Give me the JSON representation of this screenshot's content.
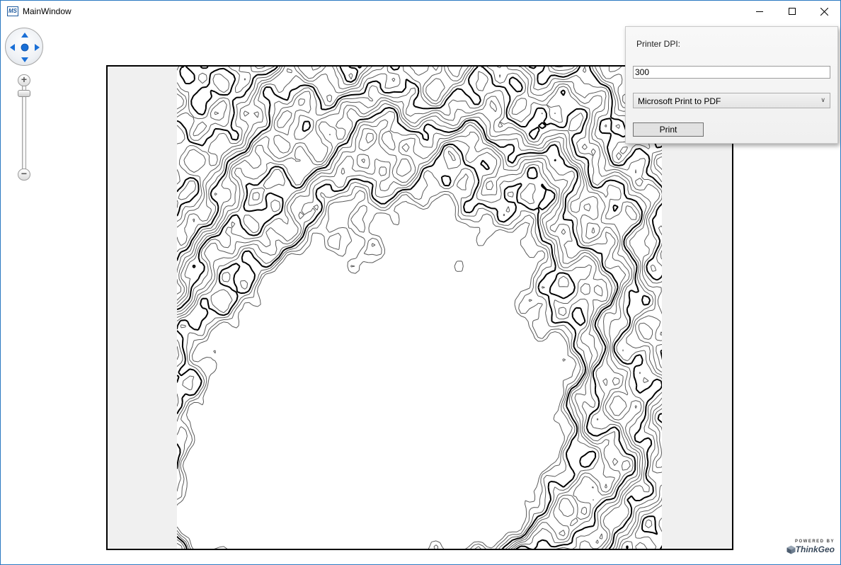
{
  "window": {
    "title": "MainWindow",
    "app_icon_text": "MS",
    "controls": {
      "minimize": "minimize-icon",
      "maximize": "maximize-icon",
      "close": "close-icon"
    }
  },
  "map_controls": {
    "pan": "pan-control",
    "zoom_in": "+",
    "zoom_out": "−",
    "zoom_level": 0.95
  },
  "print_panel": {
    "dpi_label": "Printer DPI:",
    "dpi_value": "300",
    "printer_selected": "Microsoft Print to PDF",
    "print_label": "Print"
  },
  "branding": {
    "powered_by": "POWERED BY",
    "logo_text": "ThinkGeo"
  },
  "colors": {
    "window_border": "#2b79c2",
    "nav_arrow": "#1a6fd6",
    "frame_background": "#f0f0f0",
    "contour_major": "#000000",
    "contour_minor": "#5a5a5a"
  }
}
